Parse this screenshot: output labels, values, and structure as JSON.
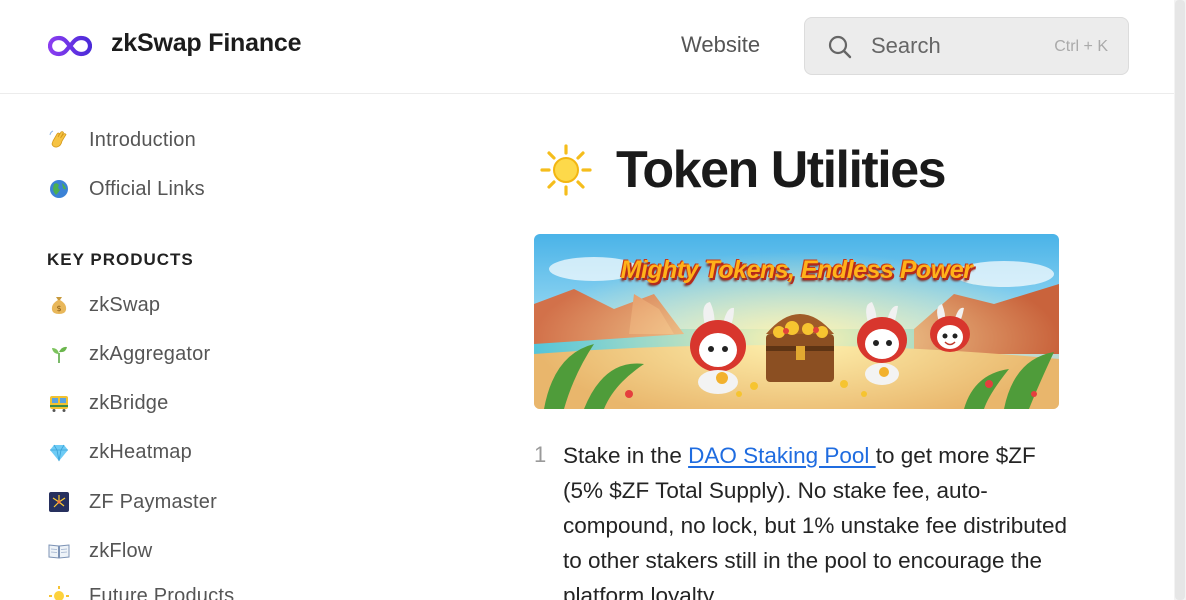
{
  "header": {
    "brand": "zkSwap Finance",
    "nav_link": "Website",
    "search": {
      "placeholder": "Search",
      "shortcut": "Ctrl + K"
    }
  },
  "sidebar": {
    "top_items": [
      {
        "label": "Introduction",
        "icon": "waving-hand-icon"
      },
      {
        "label": "Official Links",
        "icon": "globe-icon"
      }
    ],
    "section_title": "KEY PRODUCTS",
    "products": [
      {
        "label": "zkSwap",
        "icon": "money-bag-icon"
      },
      {
        "label": "zkAggregator",
        "icon": "seedling-icon"
      },
      {
        "label": "zkBridge",
        "icon": "tram-icon"
      },
      {
        "label": "zkHeatmap",
        "icon": "gem-icon"
      },
      {
        "label": "ZF Paymaster",
        "icon": "fireworks-icon"
      },
      {
        "label": "zkFlow",
        "icon": "open-book-icon"
      },
      {
        "label": "Future Products",
        "icon": "sun-icon"
      }
    ]
  },
  "page": {
    "title_icon": "sun-icon",
    "title": "Token Utilities",
    "banner_text": "Mighty Tokens, Endless Power",
    "list": [
      {
        "number": "1",
        "text_before": "Stake in the ",
        "link": "DAO Staking Pool ",
        "text_after": "to get more $ZF (5% $ZF Total Supply). No stake fee, auto-compound, no lock, but 1% unstake fee distributed to other stakers still in the pool to encourage the platform loyalty."
      }
    ]
  },
  "colors": {
    "accent_link": "#1f6ce0",
    "logo_gradient_start": "#7b3fe4",
    "logo_gradient_end": "#4a2bd6"
  }
}
